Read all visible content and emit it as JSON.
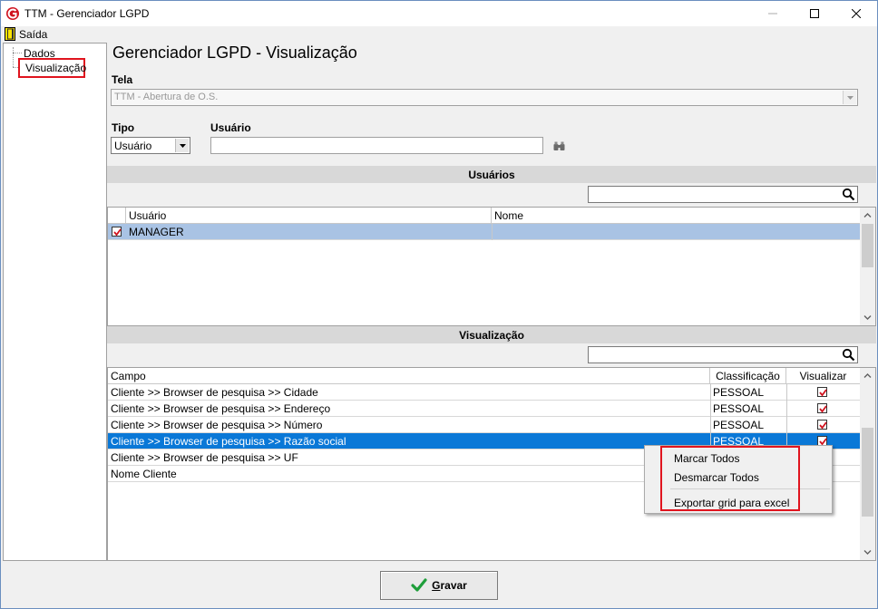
{
  "window": {
    "title": "TTM - Gerenciador LGPD"
  },
  "menu": {
    "exit_label": "Saída"
  },
  "tree": {
    "items": [
      "Dados",
      "Visualização"
    ]
  },
  "page": {
    "title": "Gerenciador LGPD - Visualização"
  },
  "form": {
    "tela_label": "Tela",
    "tela_value": "TTM - Abertura de O.S.",
    "tipo_label": "Tipo",
    "tipo_value": "Usuário",
    "usuario_label": "Usuário",
    "usuario_value": ""
  },
  "usuarios_section": {
    "header": "Usuários",
    "search_value": "",
    "columns": [
      "Usuário",
      "Nome"
    ],
    "rows": [
      {
        "checked": true,
        "usuario": "MANAGER",
        "nome": ""
      }
    ]
  },
  "visualizacao_section": {
    "header": "Visualização",
    "search_value": "",
    "columns": [
      "Campo",
      "Classificação",
      "Visualizar"
    ],
    "rows": [
      {
        "campo": "Cliente >> Browser de pesquisa >> Cidade",
        "classificacao": "PESSOAL",
        "visualizar": true
      },
      {
        "campo": "Cliente >> Browser de pesquisa >> Endereço",
        "classificacao": "PESSOAL",
        "visualizar": true
      },
      {
        "campo": "Cliente >> Browser de pesquisa >> Número",
        "classificacao": "PESSOAL",
        "visualizar": true
      },
      {
        "campo": "Cliente >> Browser de pesquisa >> Razão social",
        "classificacao": "PESSOAL",
        "visualizar": true
      },
      {
        "campo": "Cliente >> Browser de pesquisa >> UF",
        "classificacao": "",
        "visualizar": false
      },
      {
        "campo": "Nome Cliente",
        "classificacao": "",
        "visualizar": false
      }
    ],
    "selected_row": 3
  },
  "context_menu": {
    "items": [
      "Marcar Todos",
      "Desmarcar Todos",
      "Exportar grid para excel"
    ]
  },
  "buttons": {
    "save_prefix": "G",
    "save_rest": "ravar"
  },
  "colors": {
    "selection": "#0a78d7",
    "highlight": "#e0141e",
    "check": "#d0131f",
    "save_icon": "#1e9e3a"
  }
}
